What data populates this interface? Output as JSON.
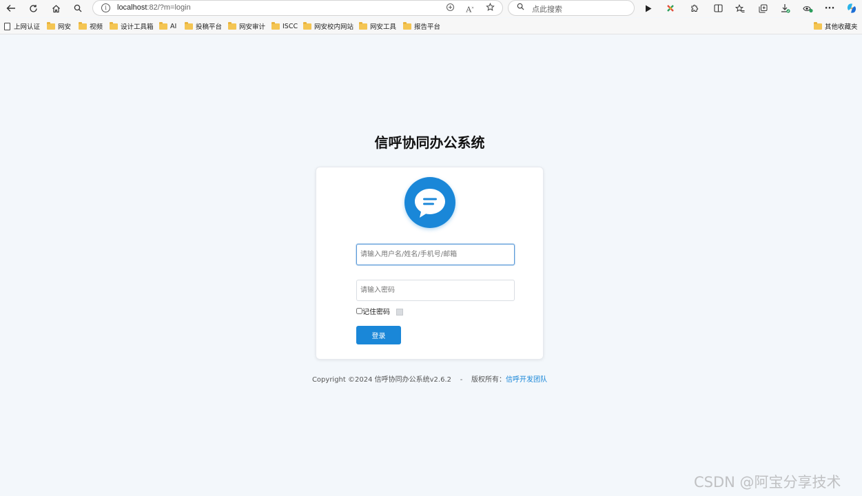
{
  "browser": {
    "url_host": "localhost",
    "url_path": ":82/?m=login",
    "search_placeholder": "点此搜索",
    "bookmarks": [
      "上网认证",
      "网安",
      "视频",
      "设计工具箱",
      "AI",
      "投稿平台",
      "网安审计",
      "ISCC",
      "网安校内网站",
      "网安工具",
      "报告平台"
    ],
    "other_bookmarks": "其他收藏夹"
  },
  "page": {
    "title": "信呼协同办公系统",
    "username_placeholder": "请输入用户名/姓名/手机号/邮箱",
    "password_placeholder": "请输入密码",
    "remember_label": "记住密码",
    "login_label": "登录",
    "remember_checked": false
  },
  "footer": {
    "copyright": "Copyright ©2024 信呼协同办公系统v2.6.2",
    "separator": "-",
    "rights_label": "版权所有：",
    "team_link": "信呼开发团队"
  },
  "watermark": "CSDN @阿宝分享技术",
  "colors": {
    "accent": "#1a87d8",
    "background": "#f3f7fb"
  },
  "icons": [
    "back-icon",
    "refresh-icon",
    "home-icon",
    "search-icon",
    "info-icon",
    "translate-icon",
    "read-aloud-icon",
    "favorite-icon",
    "play-icon",
    "extension-icon",
    "split-screen-icon",
    "favorites-icon",
    "collections-icon",
    "downloads-icon",
    "performance-icon",
    "more-icon",
    "copilot-icon",
    "chat-icon"
  ]
}
